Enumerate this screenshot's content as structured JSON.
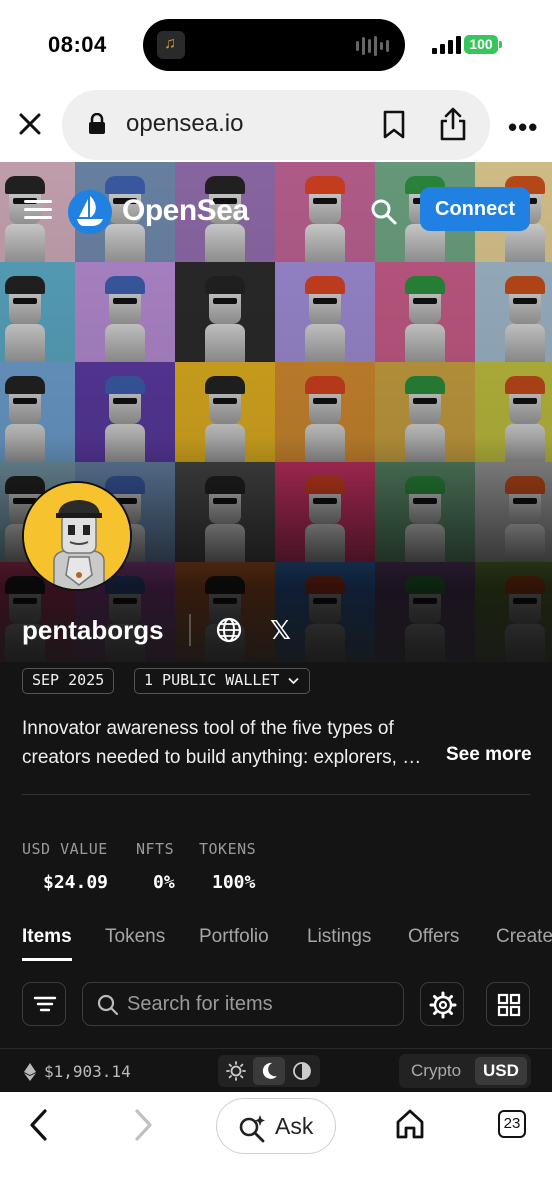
{
  "status_bar": {
    "time": "08:04",
    "battery": "100",
    "battery_color": "#35c759"
  },
  "browser": {
    "url": "opensea.io",
    "icons": [
      "close-icon",
      "lock-icon",
      "bookmark-icon",
      "share-icon",
      "more-icon"
    ]
  },
  "nav": {
    "brand": "OpenSea",
    "connect_label": "Connect",
    "accent_color": "#2081e2"
  },
  "profile": {
    "name": "pentaborgs",
    "joined_tag": "SEP 2025",
    "wallet_tag": "1 PUBLIC WALLET",
    "description_line1": "Innovator awareness tool of the five types of",
    "description_line2": "creators needed to build anything: explorers, …",
    "see_more": "See more"
  },
  "stats": [
    {
      "label": "USD VALUE",
      "value": "$24.09"
    },
    {
      "label": "NFTS",
      "value": "0%"
    },
    {
      "label": "TOKENS",
      "value": "100%"
    }
  ],
  "tabs": [
    {
      "label": "Items",
      "active": true
    },
    {
      "label": "Tokens",
      "active": false
    },
    {
      "label": "Portfolio",
      "active": false
    },
    {
      "label": "Listings",
      "active": false
    },
    {
      "label": "Offers",
      "active": false
    },
    {
      "label": "Created",
      "active": false
    }
  ],
  "search": {
    "placeholder": "Search for items"
  },
  "footer_strip": {
    "eth_price": "$1,903.14",
    "currency_options": [
      "Crypto",
      "USD"
    ],
    "currency_selected": "USD",
    "theme_selected": "dark"
  },
  "safari": {
    "ask_label": "Ask",
    "tab_count": "23"
  }
}
